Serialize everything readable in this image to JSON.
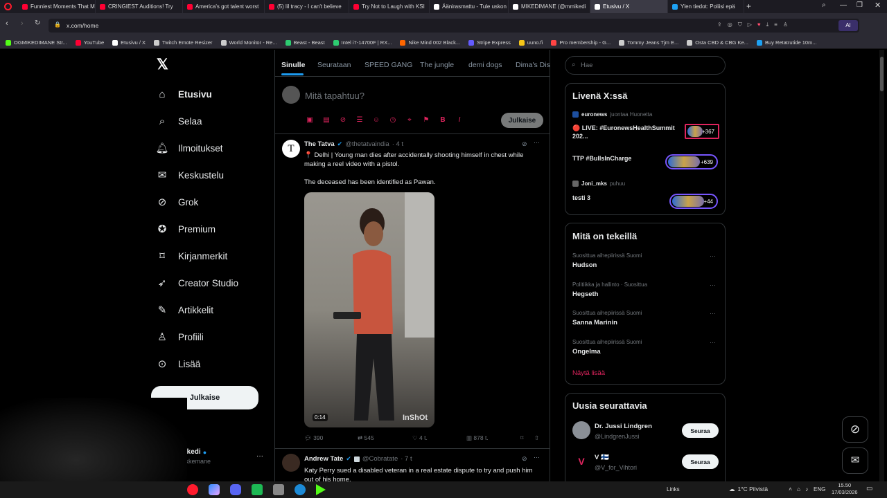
{
  "browser": {
    "tabs": [
      {
        "label": "Funniest Moments That M",
        "color": "#ff0033"
      },
      {
        "label": "CRINGIEST Auditions! Try",
        "color": "#ff0033"
      },
      {
        "label": "America's got talent worst",
        "color": "#ff0033"
      },
      {
        "label": "(5) lil tracy - I can't believe",
        "color": "#ff0033"
      },
      {
        "label": "Try Not to Laugh with KSI",
        "color": "#ff0033"
      },
      {
        "label": "Äänirasmattu - Tule uskon",
        "color": "#ffffff"
      },
      {
        "label": "MIKEDIMANE (@mmikedi",
        "color": "#ffffff"
      },
      {
        "label": "Etusivu / X",
        "color": "#ffffff",
        "active": true
      },
      {
        "label": "Ylen tiedot: Poliisi epä",
        "color": "#1da1f2"
      }
    ],
    "url": "x.com/home",
    "bookmarks": [
      {
        "label": "OGMIKEDIMANE Str...",
        "color": "#53fc18"
      },
      {
        "label": "YouTube",
        "color": "#ff0033"
      },
      {
        "label": "Etusivu / X",
        "color": "#ffffff"
      },
      {
        "label": "Twitch Emote Resizer",
        "color": "#cccccc"
      },
      {
        "label": "World Monitor - Re...",
        "color": "#cccccc"
      },
      {
        "label": "Beast - Beast",
        "color": "#2ecc71"
      },
      {
        "label": "Intel i7-14700F | RX...",
        "color": "#2ecc71"
      },
      {
        "label": "Nike Mind 002 Black...",
        "color": "#ff6600"
      },
      {
        "label": "Stripe Express",
        "color": "#635bff"
      },
      {
        "label": "uuno.fi",
        "color": "#f5c518"
      },
      {
        "label": "Pro membership - G...",
        "color": "#ff4444"
      },
      {
        "label": "Tommy Jeans Tjm E...",
        "color": "#cccccc"
      },
      {
        "label": "Osta CBD & CBG Ke...",
        "color": "#cccccc"
      },
      {
        "label": "Buy Retatrutide 10m...",
        "color": "#1da1f2"
      }
    ]
  },
  "nav": {
    "items": [
      {
        "label": "Etusivu",
        "icon": "home-icon"
      },
      {
        "label": "Selaa",
        "icon": "search-icon"
      },
      {
        "label": "Ilmoitukset",
        "icon": "bell-icon"
      },
      {
        "label": "Keskustelu",
        "icon": "mail-icon"
      },
      {
        "label": "Grok",
        "icon": "grok-icon"
      },
      {
        "label": "Premium",
        "icon": "premium-icon"
      },
      {
        "label": "Kirjanmerkit",
        "icon": "bookmark-icon"
      },
      {
        "label": "Creator Studio",
        "icon": "rocket-icon"
      },
      {
        "label": "Artikkelit",
        "icon": "article-icon"
      },
      {
        "label": "Profiili",
        "icon": "user-icon"
      },
      {
        "label": "Lisää",
        "icon": "more-icon"
      }
    ],
    "post_button": "Julkaise",
    "account_name": "mikedi",
    "account_handle": "mikkemane"
  },
  "feed": {
    "tabs": [
      "Sinulle",
      "Seurataan",
      "SPEED GANG",
      "The jungle",
      "demi dogs",
      "Dima's Dist"
    ],
    "compose_placeholder": "Mitä tapahtuu?",
    "compose_button": "Julkaise",
    "posts": [
      {
        "author": "The Tatva",
        "handle": "@thetatvaindia",
        "time": "· 4 t",
        "text1": "📍 Delhi | Young man dies after accidentally shooting himself in chest while making a reel video with a pistol.",
        "text2": "The deceased has been identified as Pawan.",
        "video_duration": "0:14",
        "video_watermark": "InShOt",
        "replies": "390",
        "reposts": "545",
        "likes": "4 t.",
        "views": "878 t."
      },
      {
        "author": "Andrew Tate",
        "handle": "@Cobratate",
        "time": "· 7 t",
        "text1": "Katy Perry sued a disabled veteran in a real estate dispute to try and push him out of his home."
      }
    ]
  },
  "right": {
    "search_placeholder": "Hae",
    "live_title": "Livenä X:ssä",
    "live": [
      {
        "host": "euronews",
        "status": "juontaa Huonetta",
        "title": "🔴 LIVE: #EuronewsHealthSummit 202...",
        "count": "+367",
        "border": "#e0245e"
      },
      {
        "host": "",
        "status": "",
        "title": "TTP #BullsInCharge",
        "count": "+639",
        "border": "#7856ff"
      },
      {
        "host": "Joni_mks",
        "status": "puhuu",
        "title": "testi 3",
        "count": "+44",
        "border": "#7856ff"
      }
    ],
    "trends_title": "Mitä on tekeillä",
    "trends": [
      {
        "context": "Suosittua aihepiirissä Suomi",
        "name": "Hudson"
      },
      {
        "context": "Politiikka ja hallinto · Suosittua",
        "name": "Hegseth"
      },
      {
        "context": "Suosittua aihepiirissä Suomi",
        "name": "Sanna Marinin"
      },
      {
        "context": "Suosittua aihepiirissä Suomi",
        "name": "Ongelma"
      }
    ],
    "show_more": "Näytä lisää",
    "follow_title": "Uusia seurattavia",
    "follow": [
      {
        "name": "Dr. Jussi Lindgren",
        "handle": "@LindgrenJussi",
        "button": "Seuraa"
      },
      {
        "name": "V 🇫🇮",
        "handle": "@V_for_Vihtori",
        "button": "Seuraa"
      }
    ]
  },
  "taskbar": {
    "links": "Links",
    "weather": "1°C  Pilvistä",
    "lang": "ENG",
    "time": "15.50",
    "date": "17/03/2026"
  }
}
